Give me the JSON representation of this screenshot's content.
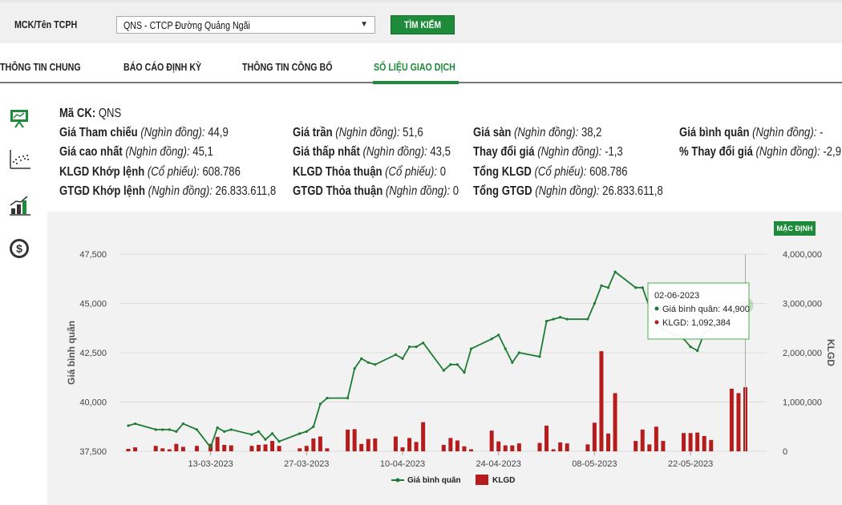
{
  "search": {
    "label": "MCK/Tên TCPH",
    "selected": "QNS - CTCP Đường Quảng Ngãi",
    "button_label": "TÌM KIẾM"
  },
  "tabs": [
    {
      "label": "THÔNG TIN CHUNG",
      "active": false
    },
    {
      "label": "BÁO CÁO ĐỊNH KỲ",
      "active": false
    },
    {
      "label": "THÔNG TIN CÔNG BỐ",
      "active": false
    },
    {
      "label": "SỐ LIỆU GIAO DỊCH",
      "active": true
    }
  ],
  "sidebar_icons": [
    "presentation-chart-icon",
    "scatter-chart-icon",
    "bar-growth-icon",
    "dollar-circle-icon"
  ],
  "info": {
    "mack": {
      "label": "Mã CK:",
      "value": "QNS"
    },
    "gia_tham_chieu": {
      "label": "Giá Tham chiếu",
      "unit": "(Nghìn đồng):",
      "value": "44,9"
    },
    "gia_tran": {
      "label": "Giá trần",
      "unit": "(Nghìn đồng):",
      "value": "51,6"
    },
    "gia_san": {
      "label": "Giá sàn",
      "unit": "(Nghìn đồng):",
      "value": "38,2"
    },
    "gia_binh_quan": {
      "label": "Giá bình quân",
      "unit": "(Nghìn đồng):",
      "value": "-"
    },
    "gia_cao_nhat": {
      "label": "Giá cao nhất",
      "unit": "(Nghìn đồng):",
      "value": "45,1"
    },
    "gia_thap_nhat": {
      "label": "Giá thấp nhất",
      "unit": "(Nghìn đồng):",
      "value": "43,5"
    },
    "thay_doi_gia": {
      "label": "Thay đổi giá",
      "unit": "(Nghìn đồng):",
      "value": "-1,3"
    },
    "pct_thay_doi_gia": {
      "label": "% Thay đổi giá",
      "unit": "(Nghìn đồng):",
      "value": "-2,9"
    },
    "klgd_khop_lenh": {
      "label": "KLGD Khớp lệnh",
      "unit": "(Cổ phiếu):",
      "value": "608.786"
    },
    "klgd_thoa_thuan": {
      "label": "KLGD Thỏa thuận",
      "unit": "(Cổ phiếu):",
      "value": "0"
    },
    "tong_klgd": {
      "label": "Tổng KLGD",
      "unit": "(Cổ phiếu):",
      "value": "608.786"
    },
    "gtgd_khop_lenh": {
      "label": "GTGD Khớp lệnh",
      "unit": "(Nghìn đồng):",
      "value": "26.833.611,8"
    },
    "gtgd_thoa_thuan": {
      "label": "GTGD Thỏa thuận",
      "unit": "(Nghìn đồng):",
      "value": "0"
    },
    "tong_gtgd": {
      "label": "Tổng GTGD",
      "unit": "(Nghìn đồng):",
      "value": "26.833.611,8"
    }
  },
  "chart": {
    "button_label": "MẶC ĐỊNH",
    "colors": {
      "price": "#1e7b34",
      "volume": "#b71c1c",
      "grid": "#dddddd"
    },
    "tooltip": {
      "date": "02-06-2023",
      "price_label": "Giá bình quân: 44,900",
      "volume_label": "KLGD: 1,092,384"
    }
  },
  "chart_data": {
    "type": "line",
    "secondary_type": "bar",
    "ylabel": "Giá bình quân",
    "y2label": "KLGD",
    "ylim": [
      37500,
      47500
    ],
    "y2lim": [
      0,
      4000000
    ],
    "yticks": [
      "47,500",
      "45,000",
      "42,500",
      "40,000",
      "37,500"
    ],
    "y2ticks": [
      "4,000,000",
      "3,000,000",
      "2,000,000",
      "1,000,000",
      "0"
    ],
    "xticks": [
      "13-03-2023",
      "27-03-2023",
      "10-04-2023",
      "24-04-2023",
      "08-05-2023",
      "22-05-2023"
    ],
    "xtick_day_index": [
      12,
      26,
      40,
      54,
      68,
      82
    ],
    "legend": [
      "Giá bình quân",
      "KLGD"
    ],
    "series": [
      {
        "name": "Giá bình quân",
        "day_index": [
          0,
          1,
          4,
          5,
          6,
          7,
          8,
          10,
          12,
          13,
          14,
          15,
          18,
          19,
          20,
          21,
          22,
          25,
          26,
          27,
          28,
          29,
          32,
          33,
          34,
          35,
          36,
          39,
          40,
          41,
          42,
          43,
          46,
          47,
          48,
          49,
          50,
          53,
          54,
          55,
          56,
          57,
          60,
          61,
          62,
          63,
          64,
          67,
          68,
          69,
          70,
          71,
          74,
          75,
          76,
          77,
          78,
          81,
          82,
          83,
          84,
          85,
          88,
          89,
          90
        ],
        "values": [
          38800,
          38900,
          38600,
          38600,
          38600,
          38500,
          38900,
          38600,
          37700,
          38700,
          38500,
          38600,
          38350,
          38500,
          38100,
          38400,
          38000,
          38400,
          38500,
          38750,
          39900,
          40200,
          40200,
          41700,
          42200,
          42000,
          41900,
          42400,
          42200,
          42800,
          42800,
          43000,
          41600,
          41900,
          41900,
          41500,
          42700,
          43200,
          43400,
          42700,
          42000,
          42500,
          42300,
          44100,
          44200,
          44300,
          44200,
          44200,
          45000,
          45900,
          45800,
          46600,
          45800,
          45800,
          44800,
          44100,
          43700,
          43200,
          42800,
          42600,
          43500,
          43700,
          44300,
          44900,
          44900
        ]
      },
      {
        "name": "KLGD",
        "day_index": [
          0,
          1,
          4,
          5,
          6,
          7,
          8,
          10,
          12,
          13,
          14,
          15,
          18,
          19,
          20,
          21,
          22,
          25,
          26,
          27,
          28,
          29,
          32,
          33,
          34,
          35,
          36,
          39,
          40,
          41,
          42,
          43,
          46,
          47,
          48,
          49,
          50,
          53,
          54,
          55,
          56,
          57,
          60,
          61,
          62,
          63,
          64,
          67,
          68,
          69,
          70,
          71,
          74,
          75,
          76,
          77,
          78,
          81,
          82,
          83,
          84,
          85,
          88,
          89,
          90
        ],
        "values": [
          50000,
          80000,
          110000,
          60000,
          40000,
          150000,
          90000,
          110000,
          150000,
          290000,
          130000,
          120000,
          110000,
          130000,
          140000,
          210000,
          110000,
          60000,
          110000,
          260000,
          300000,
          60000,
          440000,
          450000,
          150000,
          250000,
          260000,
          300000,
          80000,
          270000,
          190000,
          590000,
          130000,
          270000,
          220000,
          100000,
          40000,
          420000,
          200000,
          120000,
          120000,
          160000,
          170000,
          520000,
          40000,
          180000,
          160000,
          140000,
          580000,
          2030000,
          360000,
          1180000,
          210000,
          440000,
          140000,
          500000,
          210000,
          370000,
          370000,
          380000,
          310000,
          230000,
          1270000,
          1180000,
          1300000
        ]
      }
    ]
  }
}
